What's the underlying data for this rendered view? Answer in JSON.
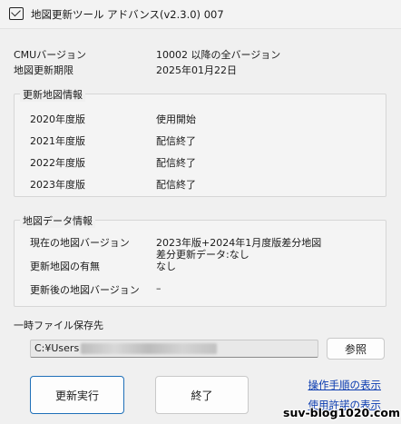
{
  "window": {
    "title": "地図更新ツール アドバンス(v2.3.0) 007"
  },
  "info": {
    "cmu_label": "CMUバージョン",
    "cmu_value": "10002 以降の全バージョン",
    "deadline_label": "地図更新期限",
    "deadline_value": "2025年01月22日"
  },
  "update_map_info": {
    "title": "更新地図情報",
    "rows": [
      {
        "label": "2020年度版",
        "value": "使用開始"
      },
      {
        "label": "2021年度版",
        "value": "配信終了"
      },
      {
        "label": "2022年度版",
        "value": "配信終了"
      },
      {
        "label": "2023年度版",
        "value": "配信終了"
      }
    ]
  },
  "map_data_info": {
    "title": "地図データ情報",
    "current_label": "現在の地図バージョン",
    "current_value_line1": "2023年版+2024年1月度版差分地図",
    "current_value_line2": "差分更新データ:なし",
    "has_update_label": "更新地図の有無",
    "has_update_value": "なし",
    "after_label": "更新後の地図バージョン",
    "after_value": "–"
  },
  "temp_folder": {
    "label": "一時ファイル保存先",
    "path_prefix": "C:¥Users",
    "browse_label": "参照"
  },
  "buttons": {
    "execute_label": "更新実行",
    "finish_label": "終了"
  },
  "links": {
    "procedure_label": "操作手順の表示",
    "license_label": "使用許諾の表示"
  },
  "watermark": "suv-blog1020.com"
}
